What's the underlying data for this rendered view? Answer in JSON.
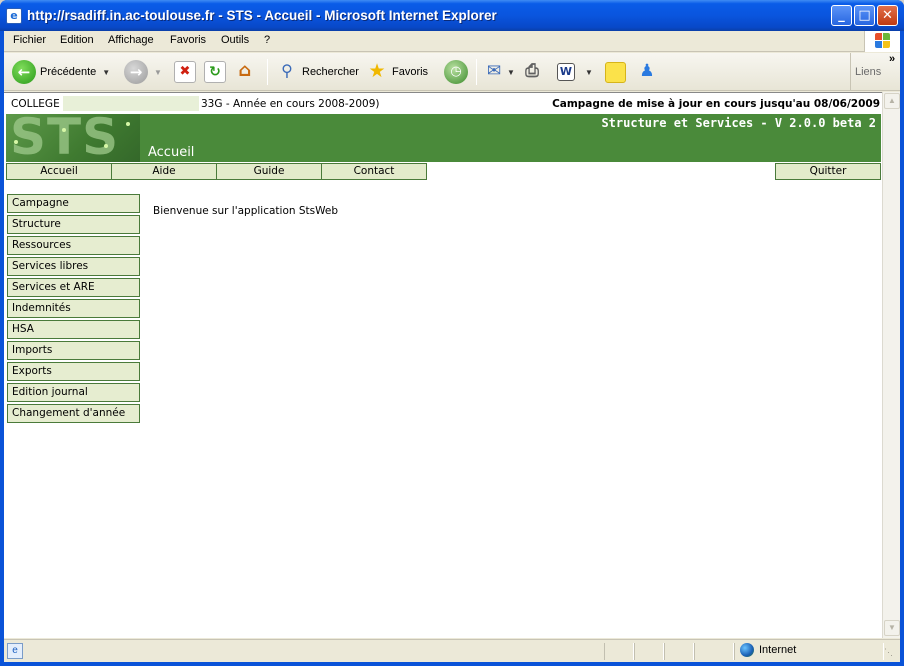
{
  "window": {
    "title": "http://rsadiff.in.ac-toulouse.fr - STS - Accueil - Microsoft Internet Explorer",
    "min_label": "_",
    "max_label": "□",
    "close_label": "✕"
  },
  "menubar": {
    "items": [
      "Fichier",
      "Edition",
      "Affichage",
      "Favoris",
      "Outils",
      "?"
    ]
  },
  "toolbar": {
    "back_label": "Précédente",
    "search_label": "Rechercher",
    "favorites_label": "Favoris",
    "links_label": "Liens",
    "links_chevron": "»"
  },
  "page": {
    "college_label": "COLLEGE",
    "college_rest": "33G - Année en cours 2008-2009)",
    "campaign_info": "Campagne de mise à jour en cours jusqu'au 08/06/2009",
    "banner_logo": "STS",
    "banner_version": "Structure et Services - V 2.0.0 beta 2",
    "banner_page": "Accueil",
    "nav_tabs": [
      "Accueil",
      "Aide",
      "Guide",
      "Contact"
    ],
    "quit_label": "Quitter",
    "side_menu": [
      "Campagne",
      "Structure",
      "Ressources",
      "Services libres",
      "Services et ARE",
      "Indemnités",
      "HSA",
      "Imports",
      "Exports",
      "Edition journal",
      "Changement d'année"
    ],
    "welcome": "Bienvenue sur l'application StsWeb"
  },
  "statusbar": {
    "zone_label": "Internet"
  },
  "colors": {
    "banner_green": "#4a8a3a",
    "tab_fill": "#e3ebcb",
    "titlebar_blue": "#0a55de"
  }
}
